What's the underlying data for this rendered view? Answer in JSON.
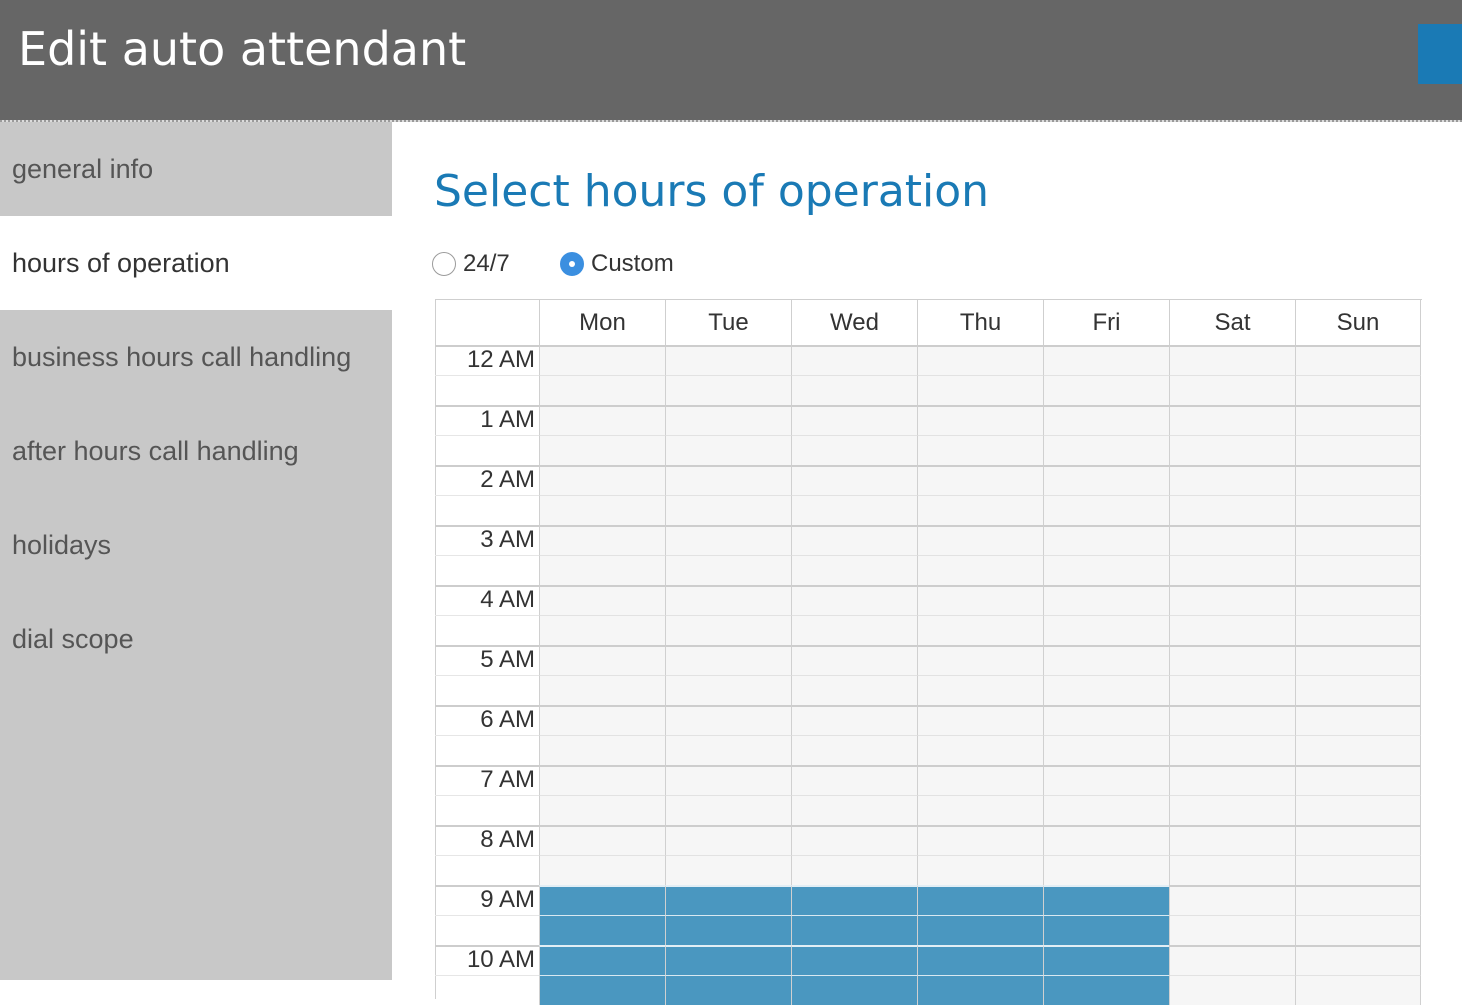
{
  "header": {
    "title": "Edit auto attendant"
  },
  "sidebar": {
    "items": [
      {
        "label": "general info",
        "active": false
      },
      {
        "label": "hours of operation",
        "active": true
      },
      {
        "label": "business hours call handling",
        "active": false
      },
      {
        "label": "after hours call handling",
        "active": false
      },
      {
        "label": "holidays",
        "active": false
      },
      {
        "label": "dial scope",
        "active": false
      }
    ]
  },
  "main": {
    "title": "Select hours of operation",
    "radio_options": [
      {
        "label": "24/7",
        "checked": false
      },
      {
        "label": "Custom",
        "checked": true
      }
    ],
    "schedule": {
      "days": [
        "Mon",
        "Tue",
        "Wed",
        "Thu",
        "Fri",
        "Sat",
        "Sun"
      ],
      "hours": [
        "12 AM",
        "1 AM",
        "2 AM",
        "3 AM",
        "4 AM",
        "5 AM",
        "6 AM",
        "7 AM",
        "8 AM",
        "9 AM",
        "10 AM"
      ],
      "selected": {
        "Mon": [
          "9 AM",
          "10 AM"
        ],
        "Tue": [
          "9 AM",
          "10 AM"
        ],
        "Wed": [
          "9 AM",
          "10 AM"
        ],
        "Thu": [
          "9 AM",
          "10 AM"
        ],
        "Fri": [
          "9 AM",
          "10 AM"
        ],
        "Sat": [],
        "Sun": []
      }
    }
  },
  "colors": {
    "header_bg": "#666666",
    "accent": "#1a7ab5",
    "sidebar_bg": "#c8c8c8",
    "selected_cell": "#4a97c0",
    "empty_cell": "#f6f6f6"
  }
}
